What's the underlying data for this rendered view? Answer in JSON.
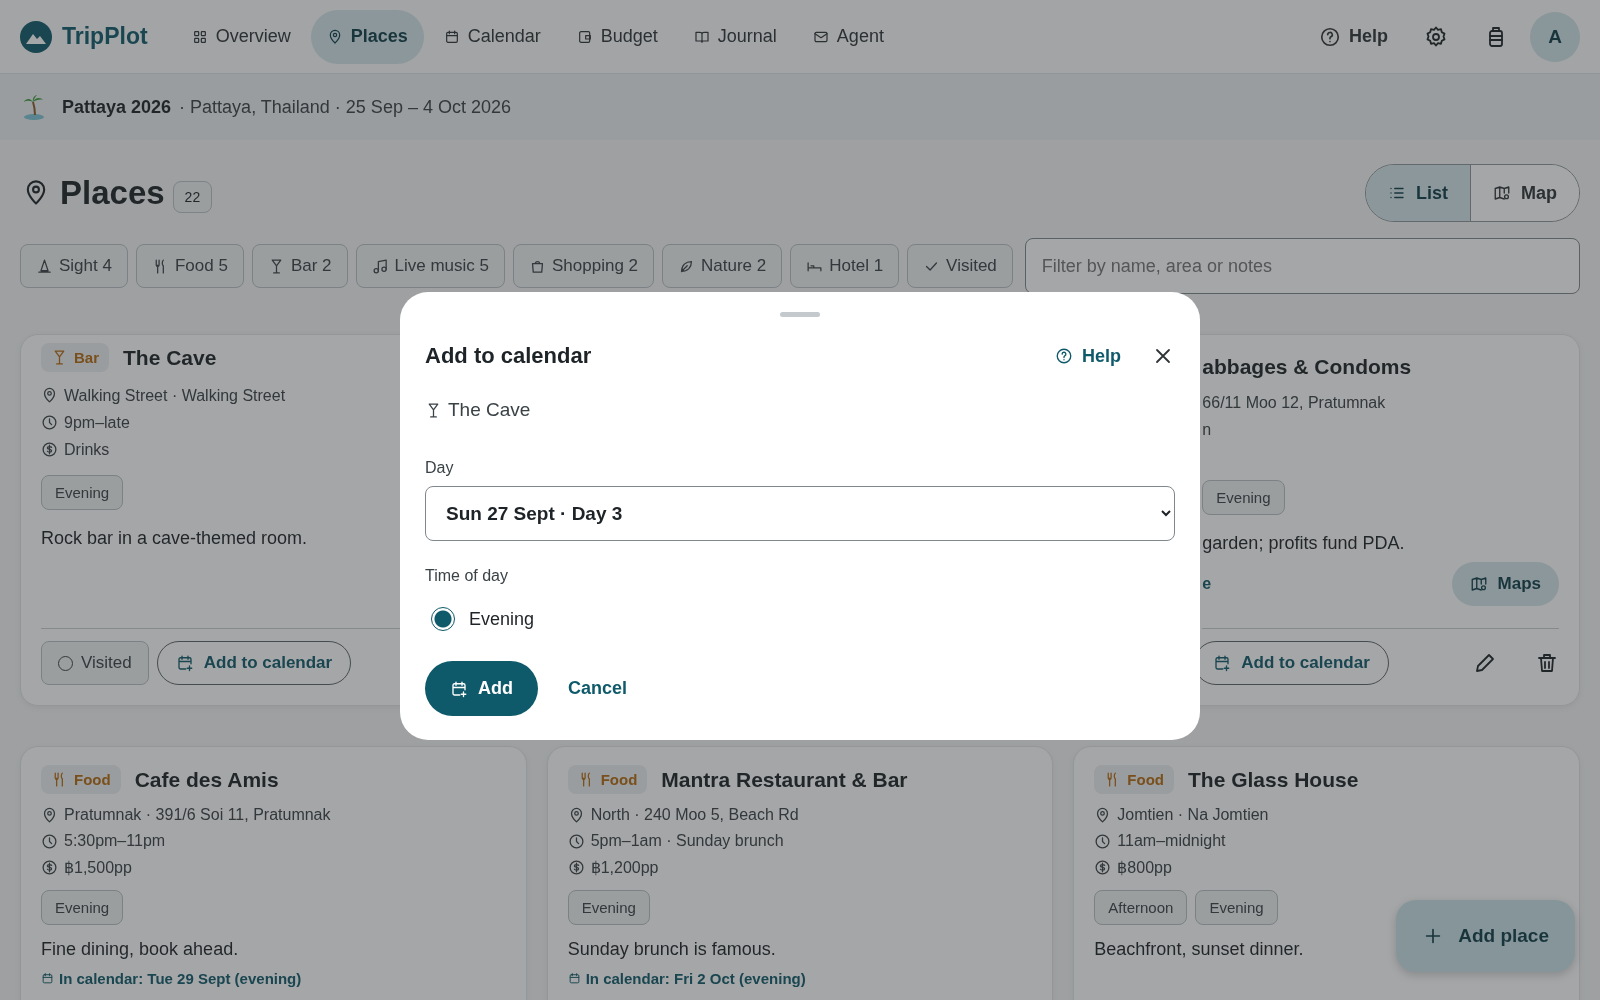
{
  "app": {
    "name": "TripPlot"
  },
  "nav": [
    {
      "label": "Overview",
      "selected": false
    },
    {
      "label": "Places",
      "selected": true
    },
    {
      "label": "Calendar",
      "selected": false
    },
    {
      "label": "Budget",
      "selected": false
    },
    {
      "label": "Journal",
      "selected": false
    },
    {
      "label": "Agent",
      "selected": false
    }
  ],
  "header_actions": {
    "help": "Help",
    "avatar": "A"
  },
  "trip": {
    "name": "Pattaya 2026",
    "details": "· Pattaya, Thailand · 25 Sep – 4 Oct 2026"
  },
  "page": {
    "title": "Places",
    "count": "22"
  },
  "view_toggle": [
    {
      "label": "List",
      "selected": true
    },
    {
      "label": "Map",
      "selected": false
    }
  ],
  "filters": [
    {
      "label": "Sight 4",
      "kind": "sight"
    },
    {
      "label": "Food 5",
      "kind": "food"
    },
    {
      "label": "Bar 2",
      "kind": "bar"
    },
    {
      "label": "Live music 5",
      "kind": "music"
    },
    {
      "label": "Shopping 2",
      "kind": "shopping"
    },
    {
      "label": "Nature 2",
      "kind": "nature"
    },
    {
      "label": "Hotel 1",
      "kind": "hotel"
    },
    {
      "label": "Visited",
      "kind": "visited"
    }
  ],
  "filter_field": {
    "placeholder": "Filter by name, area or notes"
  },
  "featured_card": {
    "category": {
      "label": "Bar",
      "kind": "bar"
    },
    "name": "The Cave",
    "area": "Walking Street · Walking Street",
    "hours": "9pm–late",
    "price": "Drinks",
    "tags": [
      "Evening"
    ],
    "note": "Rock bar in a cave-themed room.",
    "visited": {
      "label": "Visited",
      "checked": false
    },
    "add": "Add to calendar"
  },
  "partial_card": {
    "name": "abbages & Condoms",
    "address": "66/11 Moo 12, Pratumnak",
    "hours": "n",
    "tags": [
      "Evening"
    ],
    "note": "garden; profits fund PDA.",
    "link": "e",
    "maps": "Maps",
    "add": "Add to calendar"
  },
  "cards": [
    {
      "category": {
        "label": "Food",
        "kind": "food"
      },
      "name": "Cafe des Amis",
      "area": "Pratumnak · 391/6 Soi 11, Pratumnak",
      "hours": "5:30pm–11pm",
      "price": "฿1,500pp",
      "tags": [
        "Evening"
      ],
      "note": "Fine dining, book ahead.",
      "calendar": "In calendar: Tue 29 Sept (evening)"
    },
    {
      "category": {
        "label": "Food",
        "kind": "food"
      },
      "name": "Mantra Restaurant & Bar",
      "area": "North · 240 Moo 5, Beach Rd",
      "hours": "5pm–1am · Sunday brunch",
      "price": "฿1,200pp",
      "tags": [
        "Evening"
      ],
      "note": "Sunday brunch is famous.",
      "calendar": "In calendar: Fri 2 Oct (evening)"
    },
    {
      "category": {
        "label": "Food",
        "kind": "food"
      },
      "name": "The Glass House",
      "area": "Jomtien · Na Jomtien",
      "hours": "11am–midnight",
      "price": "฿800pp",
      "tags": [
        "Afternoon",
        "Evening"
      ],
      "note": "Beachfront, sunset dinner."
    }
  ],
  "fab": {
    "label": "Add place"
  },
  "dialog": {
    "title": "Add to calendar",
    "help": "Help",
    "place": {
      "name": "The Cave",
      "kind": "bar"
    },
    "day_label": "Day",
    "day_value": "Sun 27 Sept · Day 3",
    "time_label": "Time of day",
    "options": [
      {
        "label": "Evening",
        "selected": true
      }
    ],
    "confirm": "Add",
    "cancel": "Cancel"
  }
}
